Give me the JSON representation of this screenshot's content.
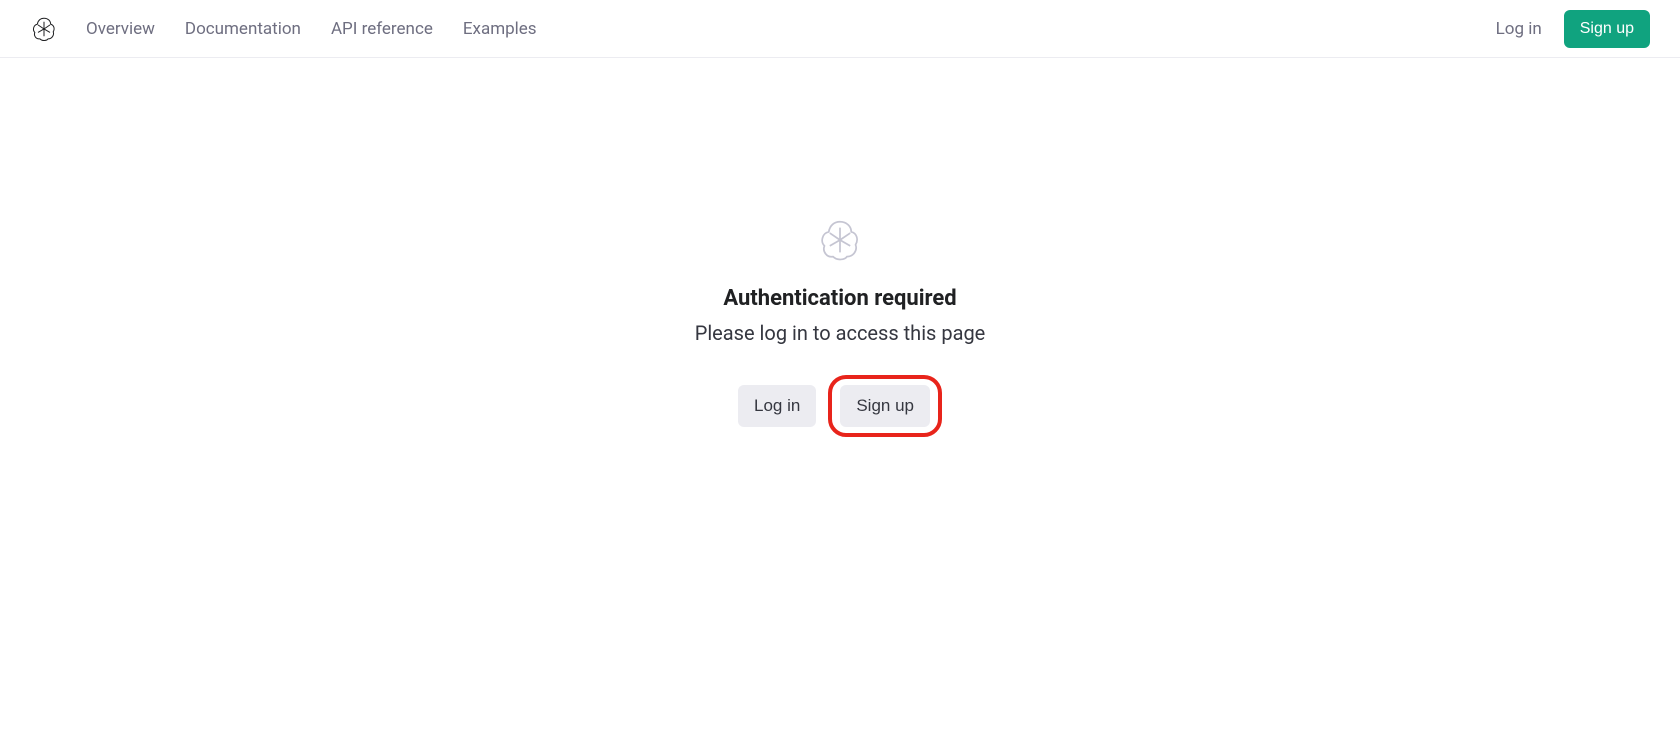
{
  "header": {
    "nav": {
      "overview": "Overview",
      "documentation": "Documentation",
      "api_reference": "API reference",
      "examples": "Examples"
    },
    "auth": {
      "login_label": "Log in",
      "signup_label": "Sign up"
    }
  },
  "main": {
    "title": "Authentication required",
    "subtitle": "Please log in to access this page",
    "login_button": "Log in",
    "signup_button": "Sign up"
  },
  "colors": {
    "accent": "#10a37f",
    "highlight": "#e8241b"
  }
}
